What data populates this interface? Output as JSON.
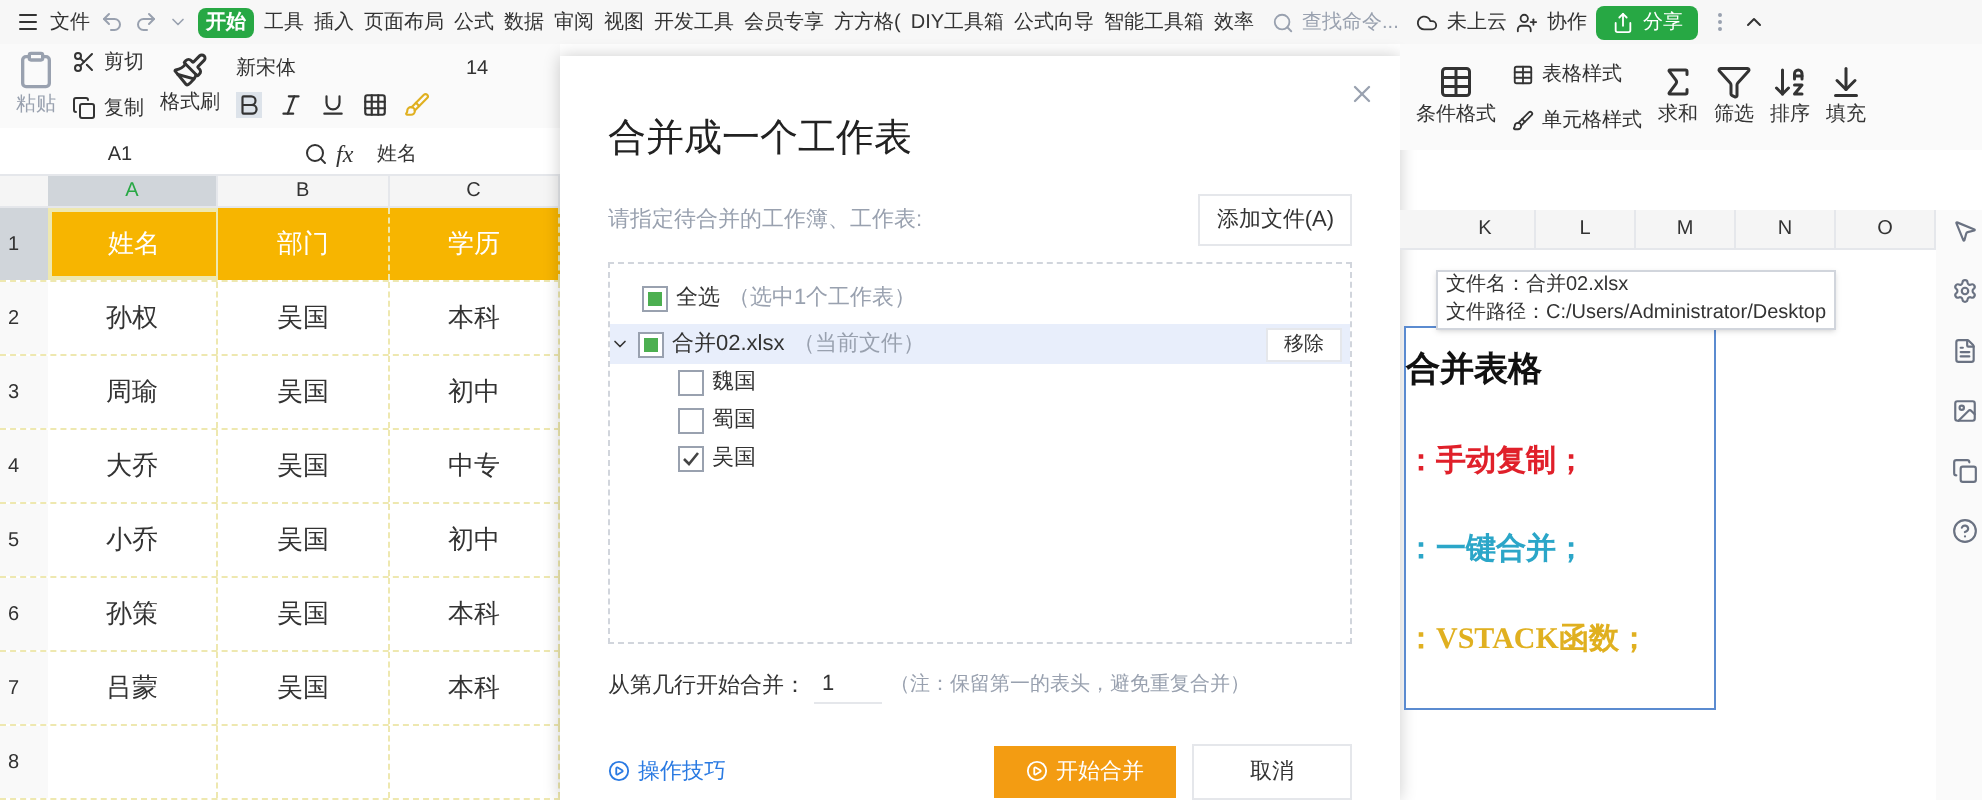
{
  "menu": {
    "file": "文件",
    "items": [
      {
        "label": "开始",
        "selected": true
      },
      {
        "label": "工具",
        "selected": false
      },
      {
        "label": "插入",
        "selected": false
      },
      {
        "label": "页面布局",
        "selected": false
      },
      {
        "label": "公式",
        "selected": false
      },
      {
        "label": "数据",
        "selected": false
      },
      {
        "label": "审阅",
        "selected": false
      },
      {
        "label": "视图",
        "selected": false
      },
      {
        "label": "开发工具",
        "selected": false
      },
      {
        "label": "会员专享",
        "selected": false
      },
      {
        "label": "方方格(",
        "selected": false
      },
      {
        "label": "DIY工具箱",
        "selected": false
      },
      {
        "label": "公式向导",
        "selected": false
      },
      {
        "label": "智能工具箱",
        "selected": false
      },
      {
        "label": "效率",
        "selected": false
      }
    ],
    "search": {
      "placeholder": "查找命令..."
    },
    "cloud": "未上云",
    "collab": "协作",
    "share": "分享"
  },
  "ribbon": {
    "paste": "粘贴",
    "cut": "剪切",
    "copy": "复制",
    "painter": "格式刷",
    "font": "新宋体",
    "font_size": "14",
    "cond_format": "条件格式",
    "table_style": "表格样式",
    "cell_style": "单元格样式",
    "sum": "求和",
    "filter": "筛选",
    "sort": "排序",
    "fill": "填充"
  },
  "formula_bar": {
    "cell": "A1",
    "fx": "fx",
    "value": "姓名"
  },
  "sheet": {
    "columns": [
      {
        "label": "A",
        "selected": true
      },
      {
        "label": "B",
        "selected": false
      },
      {
        "label": "C",
        "selected": false
      }
    ],
    "rows": [
      {
        "num": "1",
        "kind": "header",
        "cells": [
          "姓名",
          "部门",
          "学历"
        ]
      },
      {
        "num": "2",
        "kind": "data",
        "cells": [
          "孙权",
          "吴国",
          "本科"
        ]
      },
      {
        "num": "3",
        "kind": "data",
        "cells": [
          "周瑜",
          "吴国",
          "初中"
        ]
      },
      {
        "num": "4",
        "kind": "data",
        "cells": [
          "大乔",
          "吴国",
          "中专"
        ]
      },
      {
        "num": "5",
        "kind": "data",
        "cells": [
          "小乔",
          "吴国",
          "初中"
        ]
      },
      {
        "num": "6",
        "kind": "data",
        "cells": [
          "孙策",
          "吴国",
          "本科"
        ]
      },
      {
        "num": "7",
        "kind": "data",
        "cells": [
          "吕蒙",
          "吴国",
          "本科"
        ]
      },
      {
        "num": "8",
        "kind": "data",
        "cells": []
      }
    ],
    "right_columns": [
      "K",
      "L",
      "M",
      "N",
      "O"
    ]
  },
  "text_box": {
    "lines": [
      {
        "text": "合并表格",
        "color": "#111111"
      },
      {
        "text": "：手动复制；",
        "color": "#e0202a"
      },
      {
        "text": "：一键合并；",
        "color": "#2ba6c8"
      },
      {
        "text": "：VSTACK函数；",
        "color": "#e0b020"
      }
    ]
  },
  "tooltip": {
    "lines": [
      "文件名：合并02.xlsx",
      "文件路径：C:/Users/Administrator/Desktop"
    ]
  },
  "dialog": {
    "title": "合并成一个工作表",
    "subtitle": "请指定待合并的工作簿、工作表:",
    "add_button": "添加文件(A)",
    "tree": [
      {
        "label": "全选",
        "note": "（选中1个工作表）",
        "checked": false,
        "partial": true
      }
    ],
    "file": {
      "label": "合并02.xlsx",
      "note": "（当前文件）",
      "checked": false,
      "partial": true,
      "expanded": true,
      "remove": "移除",
      "children": [
        {
          "label": "魏国",
          "checked": false
        },
        {
          "label": "蜀国",
          "checked": false
        },
        {
          "label": "吴国",
          "checked": true
        }
      ]
    },
    "start_row_label": "从第几行开始合并：",
    "start_row": "1",
    "hint": "（注：保留第一的表头，避免重复合并）",
    "tips": "操作技巧",
    "start_button": "开始合并",
    "cancel": "取消"
  }
}
